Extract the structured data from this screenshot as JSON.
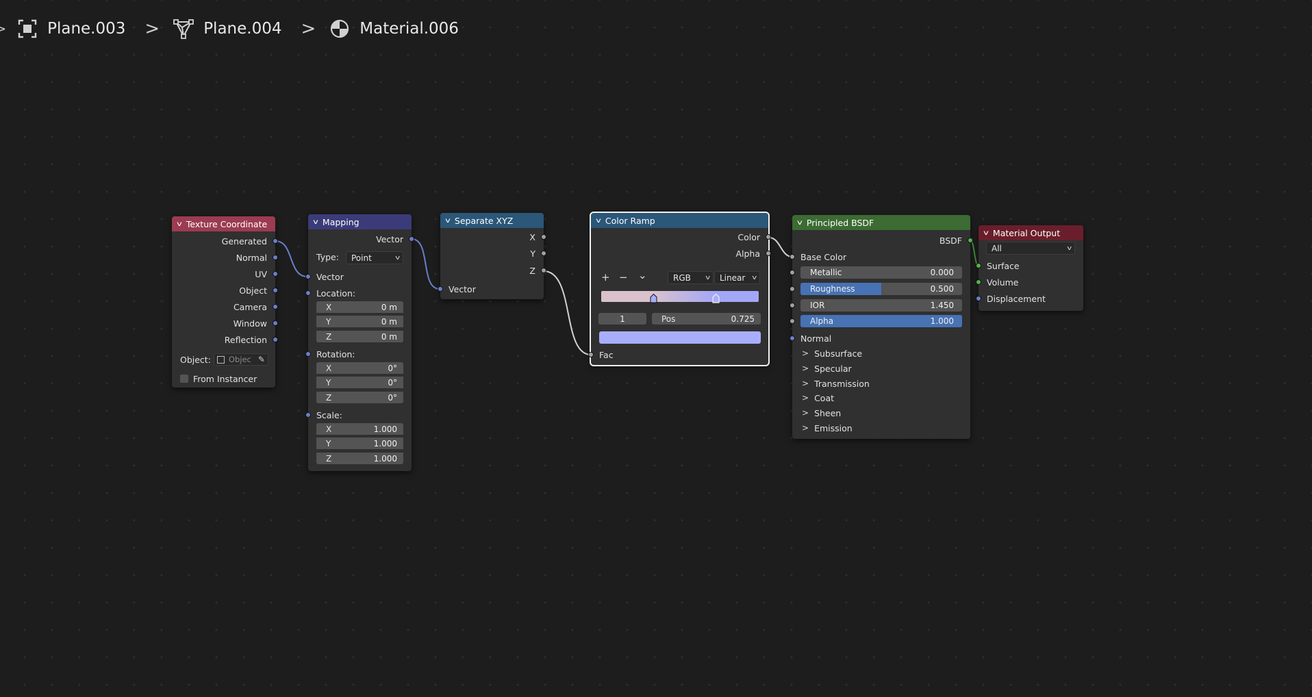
{
  "breadcrumb": {
    "items": [
      {
        "label": "Plane.003",
        "icon": "object-icon"
      },
      {
        "label": "Plane.004",
        "icon": "mesh-icon"
      },
      {
        "label": "Material.006",
        "icon": "material-icon"
      }
    ]
  },
  "colors": {
    "texture_coordinate_header": "#9c3b51",
    "mapping_header": "#3b3b7a",
    "separate_xyz_header": "#2b5778",
    "color_ramp_header": "#2b5778",
    "principled_header": "#3c6b33",
    "material_output_header": "#6a1e2b",
    "vector_socket": "#6b7ecb",
    "float_socket": "#a1a1a1",
    "slider_fill": "#4772b3",
    "ramp_start": "#d9c2cc",
    "ramp_end": "#a3a7f8",
    "ramp_stop_color": "#a9aefc"
  },
  "texture_coordinate": {
    "title": "Texture Coordinate",
    "outputs": [
      "Generated",
      "Normal",
      "UV",
      "Object",
      "Camera",
      "Window",
      "Reflection"
    ],
    "object_label": "Object:",
    "object_placeholder": "Objec",
    "from_instancer": "From Instancer"
  },
  "mapping": {
    "title": "Mapping",
    "output": "Vector",
    "type_label": "Type:",
    "type_value": "Point",
    "vector_input": "Vector",
    "location_label": "Location:",
    "location": [
      {
        "axis": "X",
        "value": "0 m"
      },
      {
        "axis": "Y",
        "value": "0 m"
      },
      {
        "axis": "Z",
        "value": "0 m"
      }
    ],
    "rotation_label": "Rotation:",
    "rotation": [
      {
        "axis": "X",
        "value": "0°"
      },
      {
        "axis": "Y",
        "value": "0°"
      },
      {
        "axis": "Z",
        "value": "0°"
      }
    ],
    "scale_label": "Scale:",
    "scale": [
      {
        "axis": "X",
        "value": "1.000"
      },
      {
        "axis": "Y",
        "value": "1.000"
      },
      {
        "axis": "Z",
        "value": "1.000"
      }
    ]
  },
  "separate_xyz": {
    "title": "Separate XYZ",
    "outputs": [
      "X",
      "Y",
      "Z"
    ],
    "input": "Vector"
  },
  "color_ramp": {
    "title": "Color Ramp",
    "outputs": [
      "Color",
      "Alpha"
    ],
    "add_btn": "+",
    "remove_btn": "−",
    "menu_btn": "⌄",
    "color_mode": "RGB",
    "interpolation": "Linear",
    "stop_positions": [
      0.33,
      0.725
    ],
    "active_index": "1",
    "pos_label": "Pos",
    "pos_value": "0.725",
    "input": "Fac"
  },
  "principled": {
    "title": "Principled BSDF",
    "output": "BSDF",
    "base_color": "Base Color",
    "sliders": [
      {
        "label": "Metallic",
        "value": "0.000",
        "fill": 0.0
      },
      {
        "label": "Roughness",
        "value": "0.500",
        "fill": 0.5
      },
      {
        "label": "IOR",
        "value": "1.450",
        "fill": 0.0
      },
      {
        "label": "Alpha",
        "value": "1.000",
        "fill": 1.0
      }
    ],
    "normal": "Normal",
    "panels": [
      "Subsurface",
      "Specular",
      "Transmission",
      "Coat",
      "Sheen",
      "Emission"
    ]
  },
  "material_output": {
    "title": "Material Output",
    "target": "All",
    "inputs": [
      "Surface",
      "Volume",
      "Displacement"
    ]
  }
}
